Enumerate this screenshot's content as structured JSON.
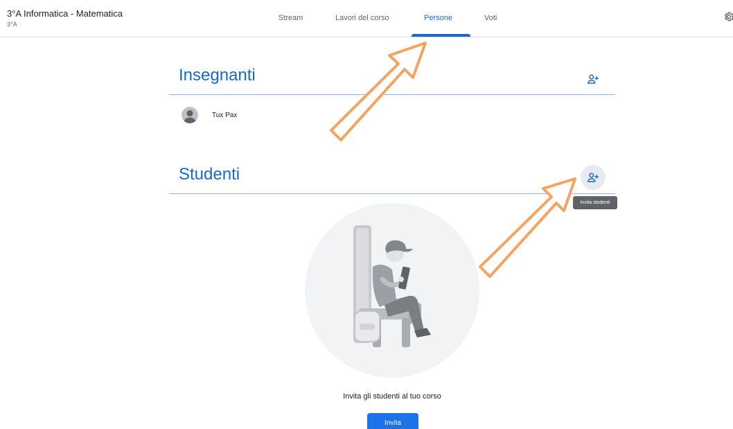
{
  "header": {
    "course_title": "3°A Informatica - Matematica",
    "course_subtitle": "3°A",
    "tabs": [
      {
        "label": "Stream",
        "active": false
      },
      {
        "label": "Lavori del corso",
        "active": false
      },
      {
        "label": "Persone",
        "active": true
      },
      {
        "label": "Voti",
        "active": false
      }
    ],
    "settings_icon": "gear-icon"
  },
  "teachers": {
    "title": "Insegnanti",
    "add_icon": "person-add-icon",
    "items": [
      {
        "name": "Tux Pax",
        "avatar_icon": "avatar-icon"
      }
    ]
  },
  "students": {
    "title": "Studenti",
    "add_icon": "person-add-icon",
    "add_tooltip": "Invita studenti"
  },
  "empty_state": {
    "message": "Invita gli studenti al tuo corso",
    "button_label": "Invita"
  },
  "colors": {
    "accent": "#1967d2",
    "button": "#1a73e8",
    "annotation_arrow": "#f4a460"
  }
}
